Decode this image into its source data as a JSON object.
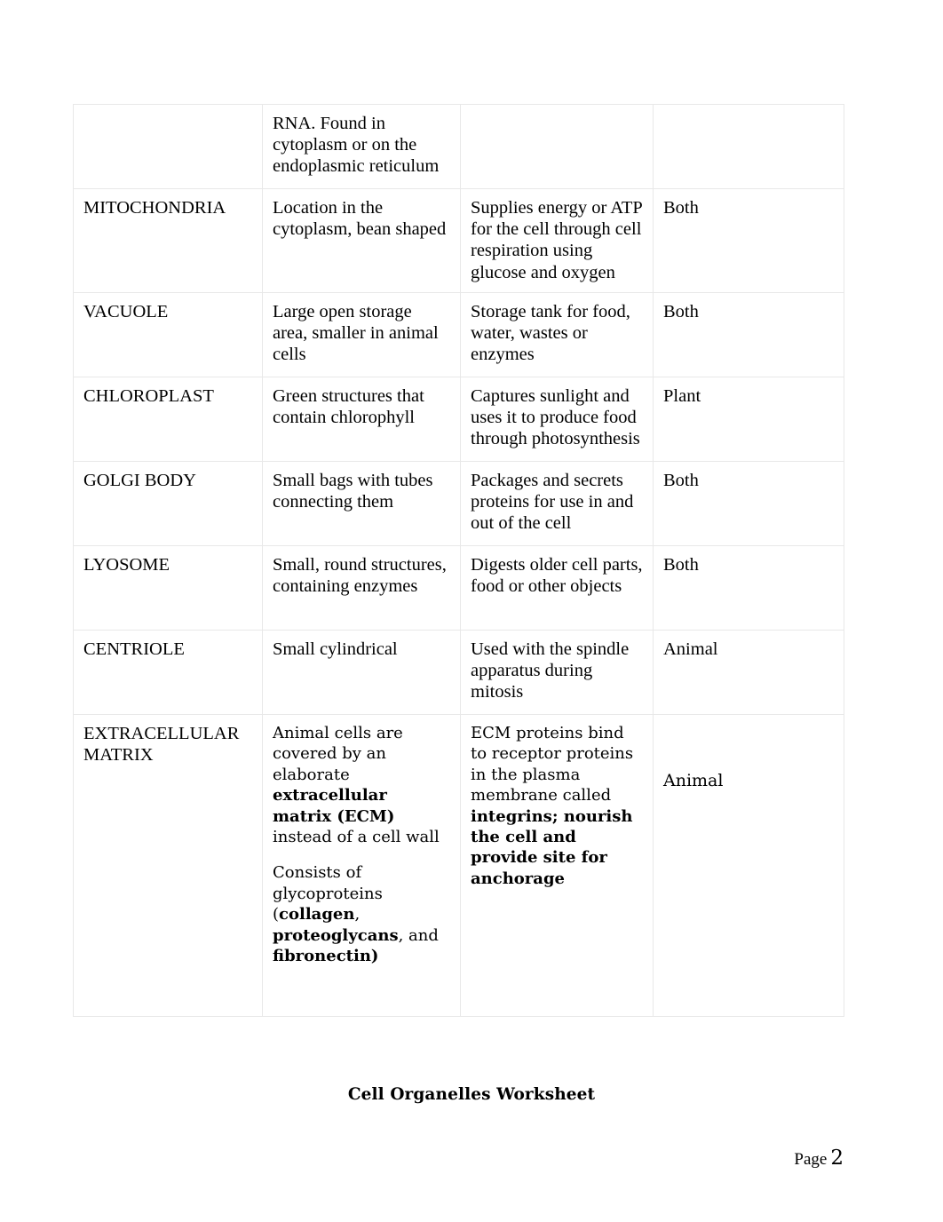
{
  "document": {
    "footer_title": "Cell Organelles Worksheet",
    "page_label": "Page",
    "page_number": "2"
  },
  "table": {
    "rows": [
      {
        "name": "",
        "description": "RNA. Found in cytoplasm or on the endoplasmic reticulum",
        "function": "",
        "cell_type": ""
      },
      {
        "name": "MITOCHONDRIA",
        "description": "Location in the cytoplasm, bean shaped",
        "function": "Supplies energy or ATP for the cell through cell respiration using glucose and oxygen",
        "cell_type": "Both"
      },
      {
        "name": "VACUOLE",
        "description": "Large open storage area, smaller in animal cells",
        "function": "Storage tank for food, water, wastes or enzymes",
        "cell_type": "Both"
      },
      {
        "name": "CHLOROPLAST",
        "description": "Green structures that contain chlorophyll",
        "function": "Captures sunlight and uses it to produce food through photosynthesis",
        "cell_type": "Plant"
      },
      {
        "name": "GOLGI BODY",
        "description": "Small bags with tubes connecting them",
        "function": "Packages and secrets proteins for use in and out of the cell",
        "cell_type": "Both"
      },
      {
        "name": "LYOSOME",
        "description": "Small, round structures, containing enzymes",
        "function": "Digests older cell parts, food or other objects",
        "cell_type": "Both"
      },
      {
        "name": "CENTRIOLE",
        "description": "Small cylindrical",
        "function": "Used with the spindle apparatus during mitosis",
        "cell_type": "Animal"
      }
    ],
    "ecm_row": {
      "name": "EXTRACELLULAR MATRIX",
      "description_p1_a": "Animal cells are covered by an elaborate ",
      "description_p1_b": "extracellular matrix (ECM)",
      "description_p1_c": " instead of a cell wall",
      "description_p2_a": "Consists of glycoproteins (",
      "description_p2_b": "collagen",
      "description_p2_c": ", ",
      "description_p2_d": "proteoglycans",
      "description_p2_e": ", and ",
      "description_p2_f": "fibronectin)",
      "function_a": "ECM proteins bind to receptor proteins in the plasma membrane called ",
      "function_b": "integrins; nourish the cell and provide site for anchorage",
      "cell_type": "Animal"
    }
  },
  "colors": {
    "page_background": "#ffffff",
    "text": "#000000",
    "table_border": "#e8e8e8"
  }
}
